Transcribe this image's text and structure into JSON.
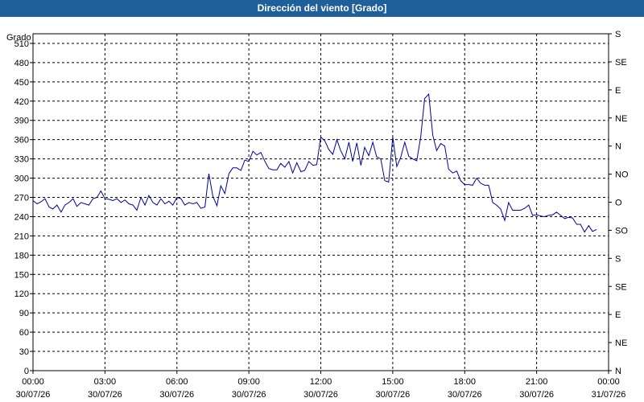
{
  "window": {
    "title": "Dirección del viento [Grado]"
  },
  "chart_data": {
    "type": "line",
    "title": "Dirección del viento [Grado]",
    "ylabel": "Grado",
    "ylim": [
      0,
      525
    ],
    "yticks": [
      0,
      30,
      60,
      90,
      120,
      150,
      180,
      210,
      240,
      270,
      300,
      330,
      360,
      390,
      420,
      450,
      480,
      510
    ],
    "right_axis_labels": [
      {
        "value": 0,
        "label": "N"
      },
      {
        "value": 45,
        "label": "NE"
      },
      {
        "value": 90,
        "label": "E"
      },
      {
        "value": 135,
        "label": "SE"
      },
      {
        "value": 180,
        "label": "S"
      },
      {
        "value": 225,
        "label": "SO"
      },
      {
        "value": 270,
        "label": "O"
      },
      {
        "value": 315,
        "label": "NO"
      },
      {
        "value": 360,
        "label": "N"
      },
      {
        "value": 405,
        "label": "NE"
      },
      {
        "value": 450,
        "label": "E"
      },
      {
        "value": 495,
        "label": "SE"
      },
      {
        "value": 540,
        "label": "S"
      }
    ],
    "xlim": [
      0,
      24
    ],
    "xticks": [
      {
        "hour": 0,
        "time": "00:00",
        "date": "30/07/26"
      },
      {
        "hour": 3,
        "time": "03:00",
        "date": "30/07/26"
      },
      {
        "hour": 6,
        "time": "06:00",
        "date": "30/07/26"
      },
      {
        "hour": 9,
        "time": "09:00",
        "date": "30/07/26"
      },
      {
        "hour": 12,
        "time": "12:00",
        "date": "30/07/26"
      },
      {
        "hour": 15,
        "time": "15:00",
        "date": "30/07/26"
      },
      {
        "hour": 18,
        "time": "18:00",
        "date": "30/07/26"
      },
      {
        "hour": 21,
        "time": "21:00",
        "date": "30/07/26"
      },
      {
        "hour": 24,
        "time": "00:00",
        "date": "31/07/26"
      }
    ],
    "grid": true,
    "series": [
      {
        "color": "#0000a0",
        "points": [
          [
            0.0,
            265
          ],
          [
            0.17,
            260
          ],
          [
            0.33,
            263
          ],
          [
            0.5,
            268
          ],
          [
            0.67,
            255
          ],
          [
            0.83,
            252
          ],
          [
            1.0,
            258
          ],
          [
            1.17,
            247
          ],
          [
            1.33,
            258
          ],
          [
            1.5,
            262
          ],
          [
            1.67,
            268
          ],
          [
            1.83,
            256
          ],
          [
            2.0,
            262
          ],
          [
            2.17,
            260
          ],
          [
            2.33,
            258
          ],
          [
            2.5,
            268
          ],
          [
            2.67,
            270
          ],
          [
            2.83,
            280
          ],
          [
            3.0,
            268
          ],
          [
            3.17,
            267
          ],
          [
            3.33,
            265
          ],
          [
            3.5,
            268
          ],
          [
            3.67,
            262
          ],
          [
            3.83,
            266
          ],
          [
            4.0,
            260
          ],
          [
            4.17,
            258
          ],
          [
            4.33,
            250
          ],
          [
            4.5,
            270
          ],
          [
            4.67,
            258
          ],
          [
            4.83,
            273
          ],
          [
            5.0,
            262
          ],
          [
            5.17,
            258
          ],
          [
            5.33,
            268
          ],
          [
            5.5,
            260
          ],
          [
            5.67,
            264
          ],
          [
            5.83,
            258
          ],
          [
            6.0,
            270
          ],
          [
            6.17,
            268
          ],
          [
            6.33,
            258
          ],
          [
            6.5,
            262
          ],
          [
            6.67,
            260
          ],
          [
            6.83,
            262
          ],
          [
            7.0,
            253
          ],
          [
            7.17,
            255
          ],
          [
            7.33,
            307
          ],
          [
            7.5,
            272
          ],
          [
            7.67,
            257
          ],
          [
            7.83,
            288
          ],
          [
            8.0,
            276
          ],
          [
            8.17,
            307
          ],
          [
            8.33,
            316
          ],
          [
            8.5,
            316
          ],
          [
            8.67,
            312
          ],
          [
            8.83,
            328
          ],
          [
            9.0,
            326
          ],
          [
            9.17,
            342
          ],
          [
            9.33,
            336
          ],
          [
            9.5,
            340
          ],
          [
            9.67,
            326
          ],
          [
            9.83,
            315
          ],
          [
            10.0,
            313
          ],
          [
            10.17,
            313
          ],
          [
            10.33,
            323
          ],
          [
            10.5,
            317
          ],
          [
            10.67,
            326
          ],
          [
            10.83,
            308
          ],
          [
            11.0,
            324
          ],
          [
            11.17,
            310
          ],
          [
            11.33,
            312
          ],
          [
            11.5,
            326
          ],
          [
            11.67,
            320
          ],
          [
            11.83,
            321
          ],
          [
            12.0,
            364
          ],
          [
            12.17,
            358
          ],
          [
            12.33,
            345
          ],
          [
            12.5,
            337
          ],
          [
            12.67,
            360
          ],
          [
            12.83,
            343
          ],
          [
            13.0,
            330
          ],
          [
            13.17,
            356
          ],
          [
            13.33,
            326
          ],
          [
            13.5,
            355
          ],
          [
            13.67,
            320
          ],
          [
            13.83,
            348
          ],
          [
            14.0,
            335
          ],
          [
            14.17,
            356
          ],
          [
            14.33,
            333
          ],
          [
            14.5,
            330
          ],
          [
            14.67,
            296
          ],
          [
            14.83,
            294
          ],
          [
            15.0,
            364
          ],
          [
            15.17,
            318
          ],
          [
            15.33,
            332
          ],
          [
            15.5,
            356
          ],
          [
            15.67,
            334
          ],
          [
            15.83,
            330
          ],
          [
            16.0,
            327
          ],
          [
            16.17,
            365
          ],
          [
            16.33,
            424
          ],
          [
            16.5,
            431
          ],
          [
            16.67,
            367
          ],
          [
            16.83,
            343
          ],
          [
            17.0,
            354
          ],
          [
            17.17,
            350
          ],
          [
            17.33,
            314
          ],
          [
            17.5,
            308
          ],
          [
            17.67,
            311
          ],
          [
            17.83,
            296
          ],
          [
            18.0,
            290
          ],
          [
            18.17,
            290
          ],
          [
            18.33,
            289
          ],
          [
            18.5,
            300
          ],
          [
            18.67,
            292
          ],
          [
            18.83,
            289
          ],
          [
            19.0,
            289
          ],
          [
            19.17,
            262
          ],
          [
            19.33,
            258
          ],
          [
            19.5,
            252
          ],
          [
            19.67,
            234
          ],
          [
            19.83,
            262
          ],
          [
            20.0,
            250
          ],
          [
            20.17,
            250
          ],
          [
            20.33,
            250
          ],
          [
            20.5,
            253
          ],
          [
            20.67,
            258
          ],
          [
            20.83,
            242
          ],
          [
            21.0,
            243
          ],
          [
            21.17,
            241
          ],
          [
            21.33,
            240
          ],
          [
            21.5,
            242
          ],
          [
            21.67,
            243
          ],
          [
            21.83,
            247
          ],
          [
            22.0,
            242
          ],
          [
            22.17,
            237
          ],
          [
            22.33,
            239
          ],
          [
            22.5,
            238
          ],
          [
            22.67,
            228
          ],
          [
            22.83,
            228
          ],
          [
            23.0,
            216
          ],
          [
            23.17,
            226
          ],
          [
            23.33,
            217
          ],
          [
            23.5,
            220
          ]
        ]
      }
    ]
  }
}
